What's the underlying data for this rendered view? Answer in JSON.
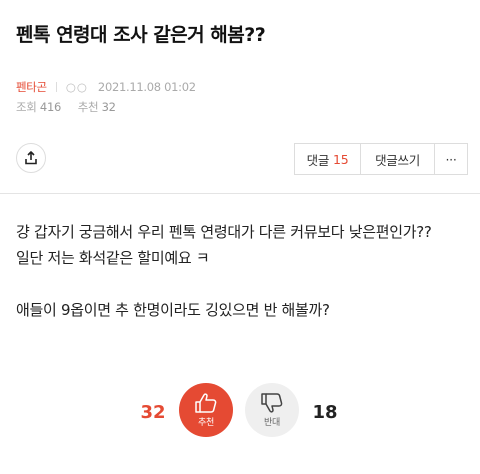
{
  "post": {
    "title": "펜톡 연령대 조사 같은거 해봄??",
    "category": "펜타곤",
    "author": "○○",
    "date": "2021.11.08 01:02",
    "views_label": "조회",
    "views": "416",
    "recommend_label": "추천",
    "recommend": "32",
    "body_lines": [
      "걍 갑자기 궁금해서 우리 펜톡 연령대가 다른 커뮤보다 낮은편인가??",
      "일단 저는 화석같은 할미예요 ㅋ",
      "",
      "애들이 9옵이면 추 한명이라도 깅있으면 반 해볼까?"
    ]
  },
  "actions": {
    "comment_label": "댓글",
    "comment_count": "15",
    "write_comment_label": "댓글쓰기",
    "more_label": "···",
    "share_icon": "share-icon"
  },
  "votes": {
    "up_count": "32",
    "up_label": "추천",
    "down_count": "18",
    "down_label": "반대",
    "up_color": "#e54a33",
    "down_color": "#efefef"
  },
  "colors": {
    "accent": "#e54a33",
    "meta_text": "#aaaaaa"
  }
}
